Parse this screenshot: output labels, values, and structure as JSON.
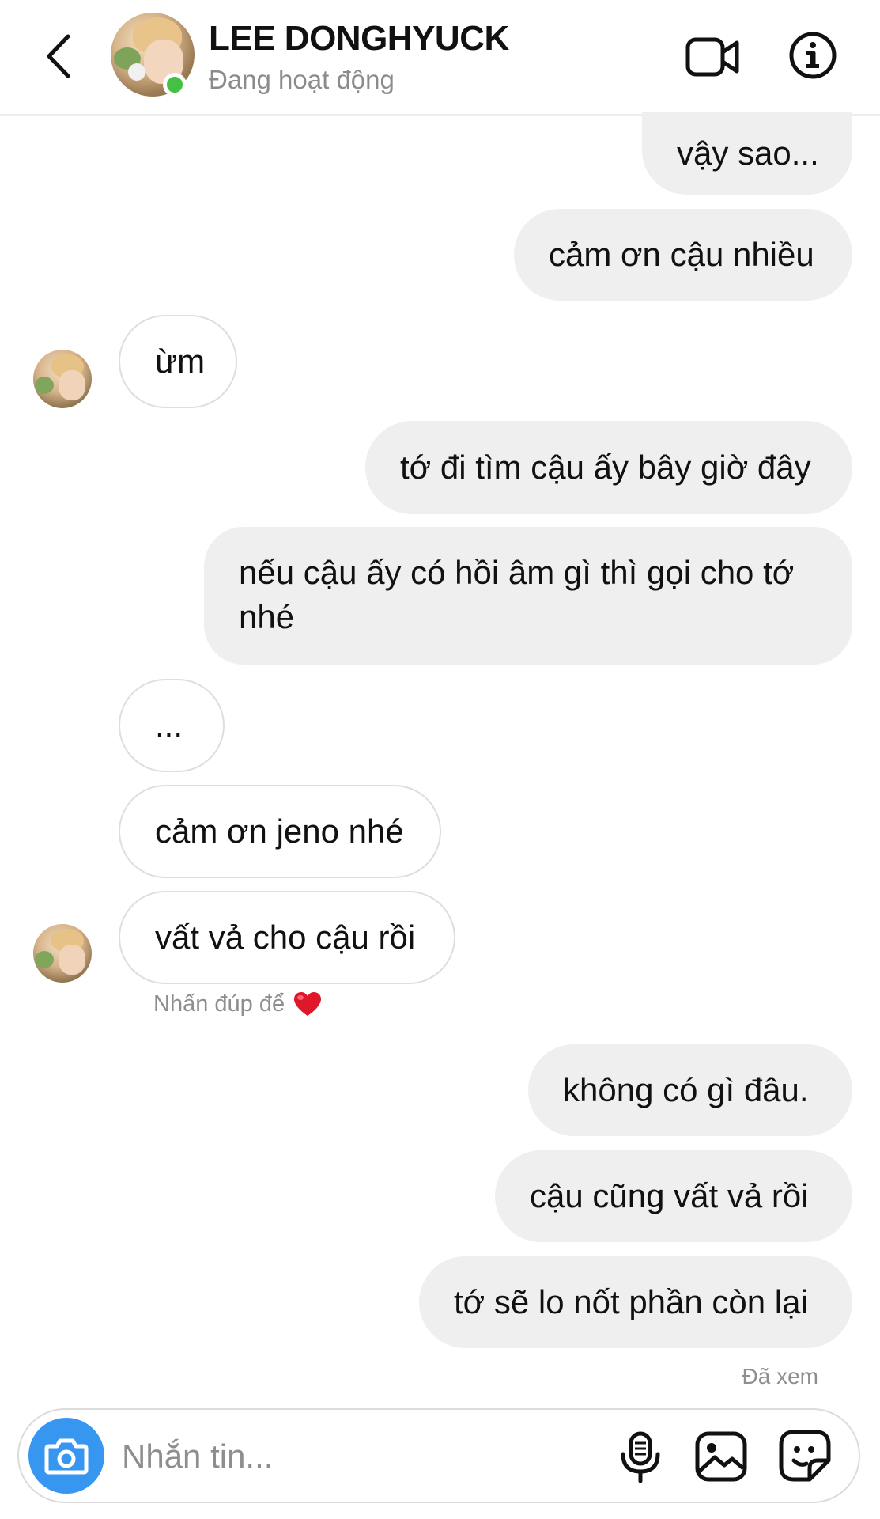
{
  "header": {
    "title": "LEE DONGHYUCK",
    "status": "Đang hoạt động",
    "icons": [
      "back-icon",
      "video-call-icon",
      "info-icon"
    ]
  },
  "messages": [
    {
      "sender": "me",
      "text": "vậy sao..."
    },
    {
      "sender": "me",
      "text": "cảm ơn cậu nhiều"
    },
    {
      "sender": "them",
      "text": "ừm"
    },
    {
      "sender": "me",
      "text": "tớ đi tìm cậu ấy bây giờ đây"
    },
    {
      "sender": "me",
      "text": "nếu cậu ấy có hồi âm gì thì gọi cho tớ nhé"
    },
    {
      "sender": "them",
      "text": "..."
    },
    {
      "sender": "them",
      "text": "cảm ơn jeno nhé"
    },
    {
      "sender": "them",
      "text": "vất vả cho cậu rồi"
    },
    {
      "sender": "me",
      "text": "không có gì đâu."
    },
    {
      "sender": "me",
      "text": "cậu cũng vất vả rồi"
    },
    {
      "sender": "me",
      "text": "tớ sẽ lo nốt phần còn lại"
    }
  ],
  "hint": {
    "text": "Nhấn đúp để",
    "icon": "heart-icon",
    "heart_color": "#e0162b"
  },
  "seen_label": "Đã xem",
  "composer": {
    "placeholder": "Nhắn tin...",
    "icons": [
      "camera-icon",
      "microphone-icon",
      "gallery-icon",
      "sticker-icon"
    ],
    "camera_color": "#3797f0"
  },
  "colors": {
    "online": "#44c144",
    "outgoing_bubble": "#efefef",
    "muted_text": "#8e8e8e"
  }
}
